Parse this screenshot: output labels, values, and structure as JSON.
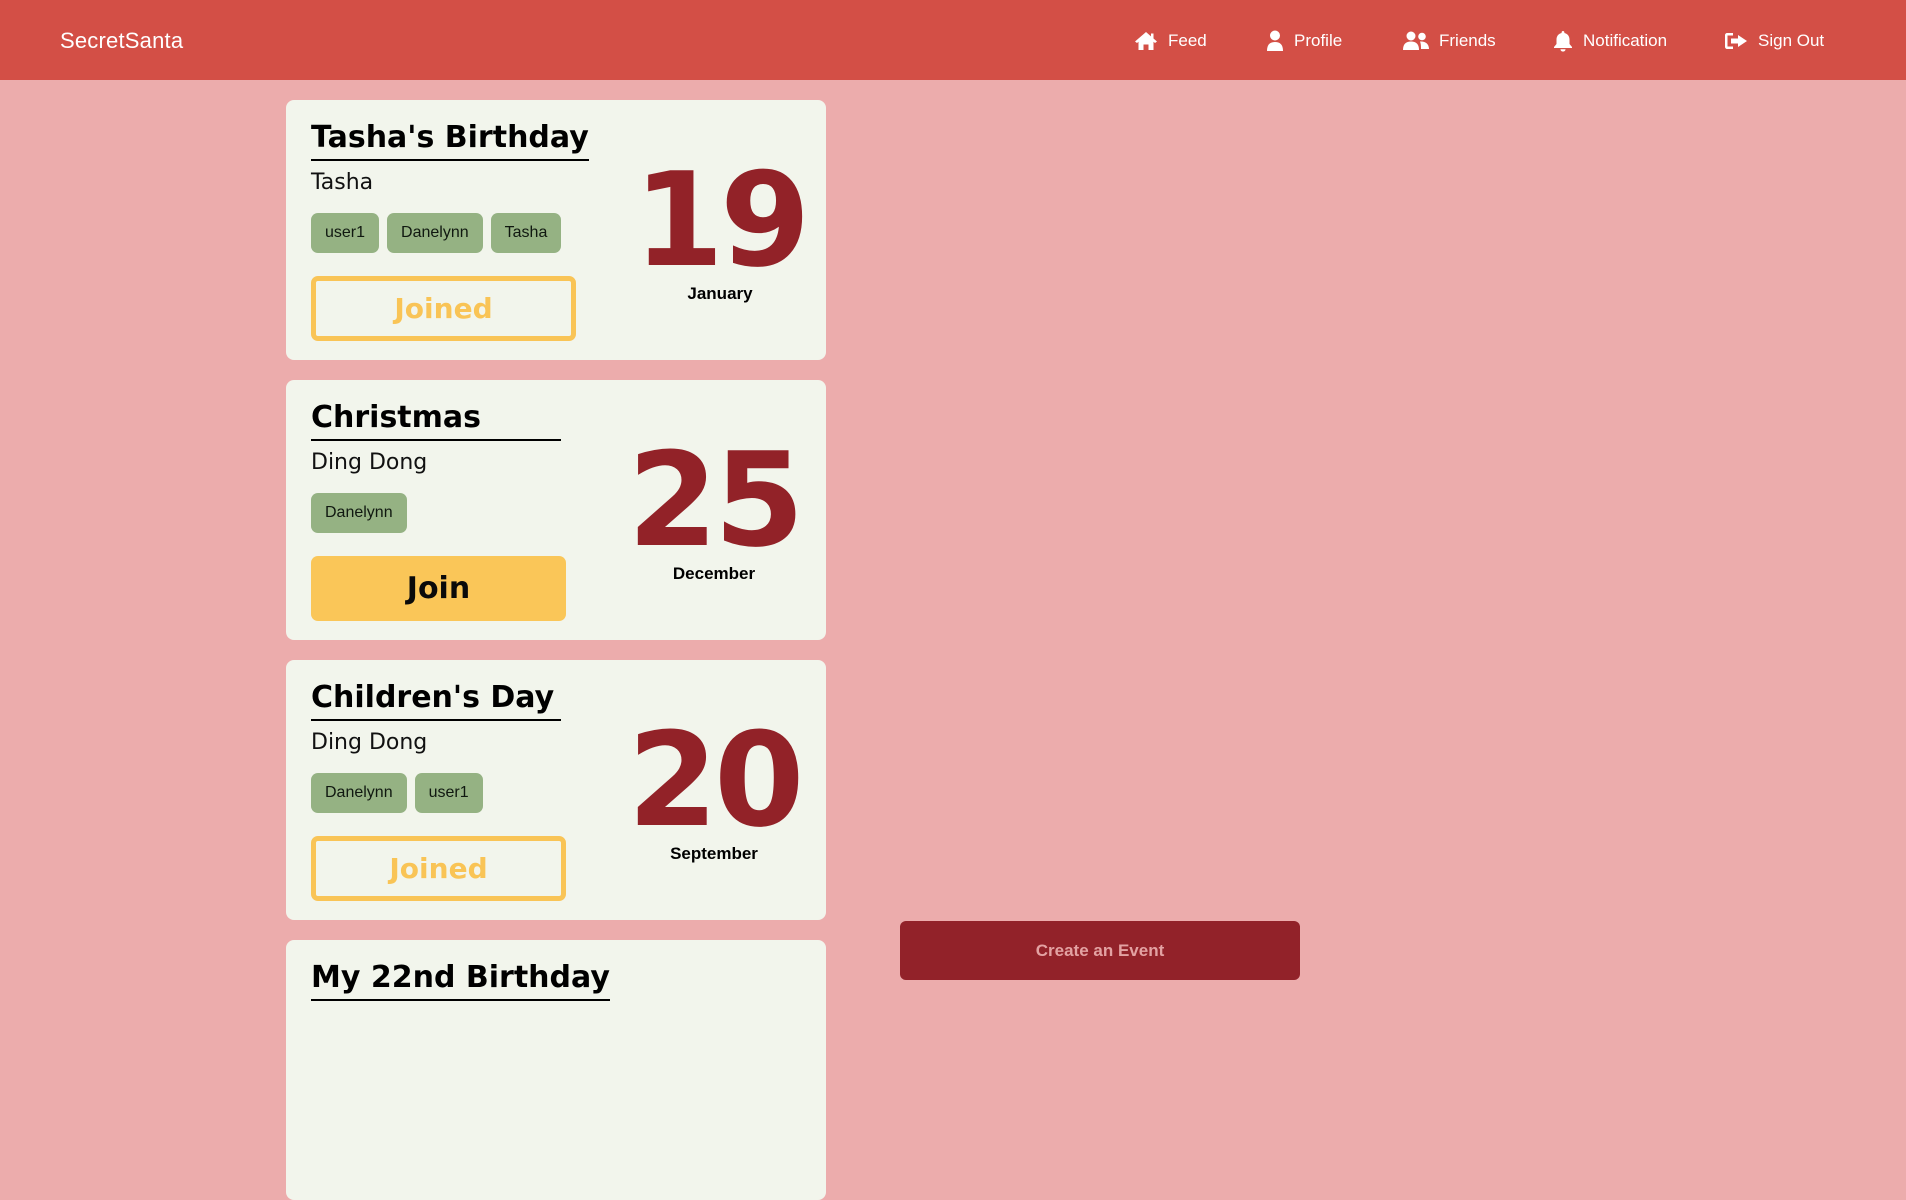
{
  "nav": {
    "brand": "SecretSanta",
    "items": [
      {
        "label": "Feed",
        "icon": "home-icon"
      },
      {
        "label": "Profile",
        "icon": "user-icon"
      },
      {
        "label": "Friends",
        "icon": "users-icon"
      },
      {
        "label": "Notification",
        "icon": "bell-icon"
      },
      {
        "label": "Sign Out",
        "icon": "sign-out-icon"
      }
    ]
  },
  "events": [
    {
      "title": "Tasha's Birthday",
      "host": "Tasha",
      "participants": [
        "user1",
        "Danelynn",
        "Tasha"
      ],
      "action": "Joined",
      "day": "19",
      "month": "January"
    },
    {
      "title": "Christmas",
      "host": "Ding Dong",
      "participants": [
        "Danelynn"
      ],
      "action": "Join",
      "day": "25",
      "month": "December"
    },
    {
      "title": "Children's Day",
      "host": "Ding Dong",
      "participants": [
        "Danelynn",
        "user1"
      ],
      "action": "Joined",
      "day": "20",
      "month": "September"
    },
    {
      "title": "My 22nd Birthday"
    }
  ],
  "create_event": {
    "label": "Create an Event"
  },
  "colors": {
    "navbar": "#d34f46",
    "background": "#ecacac",
    "card": "#f2f5ec",
    "tag": "#95b283",
    "accent_yellow": "#f9c456",
    "date_red": "#922228",
    "create_button": "#922229"
  }
}
